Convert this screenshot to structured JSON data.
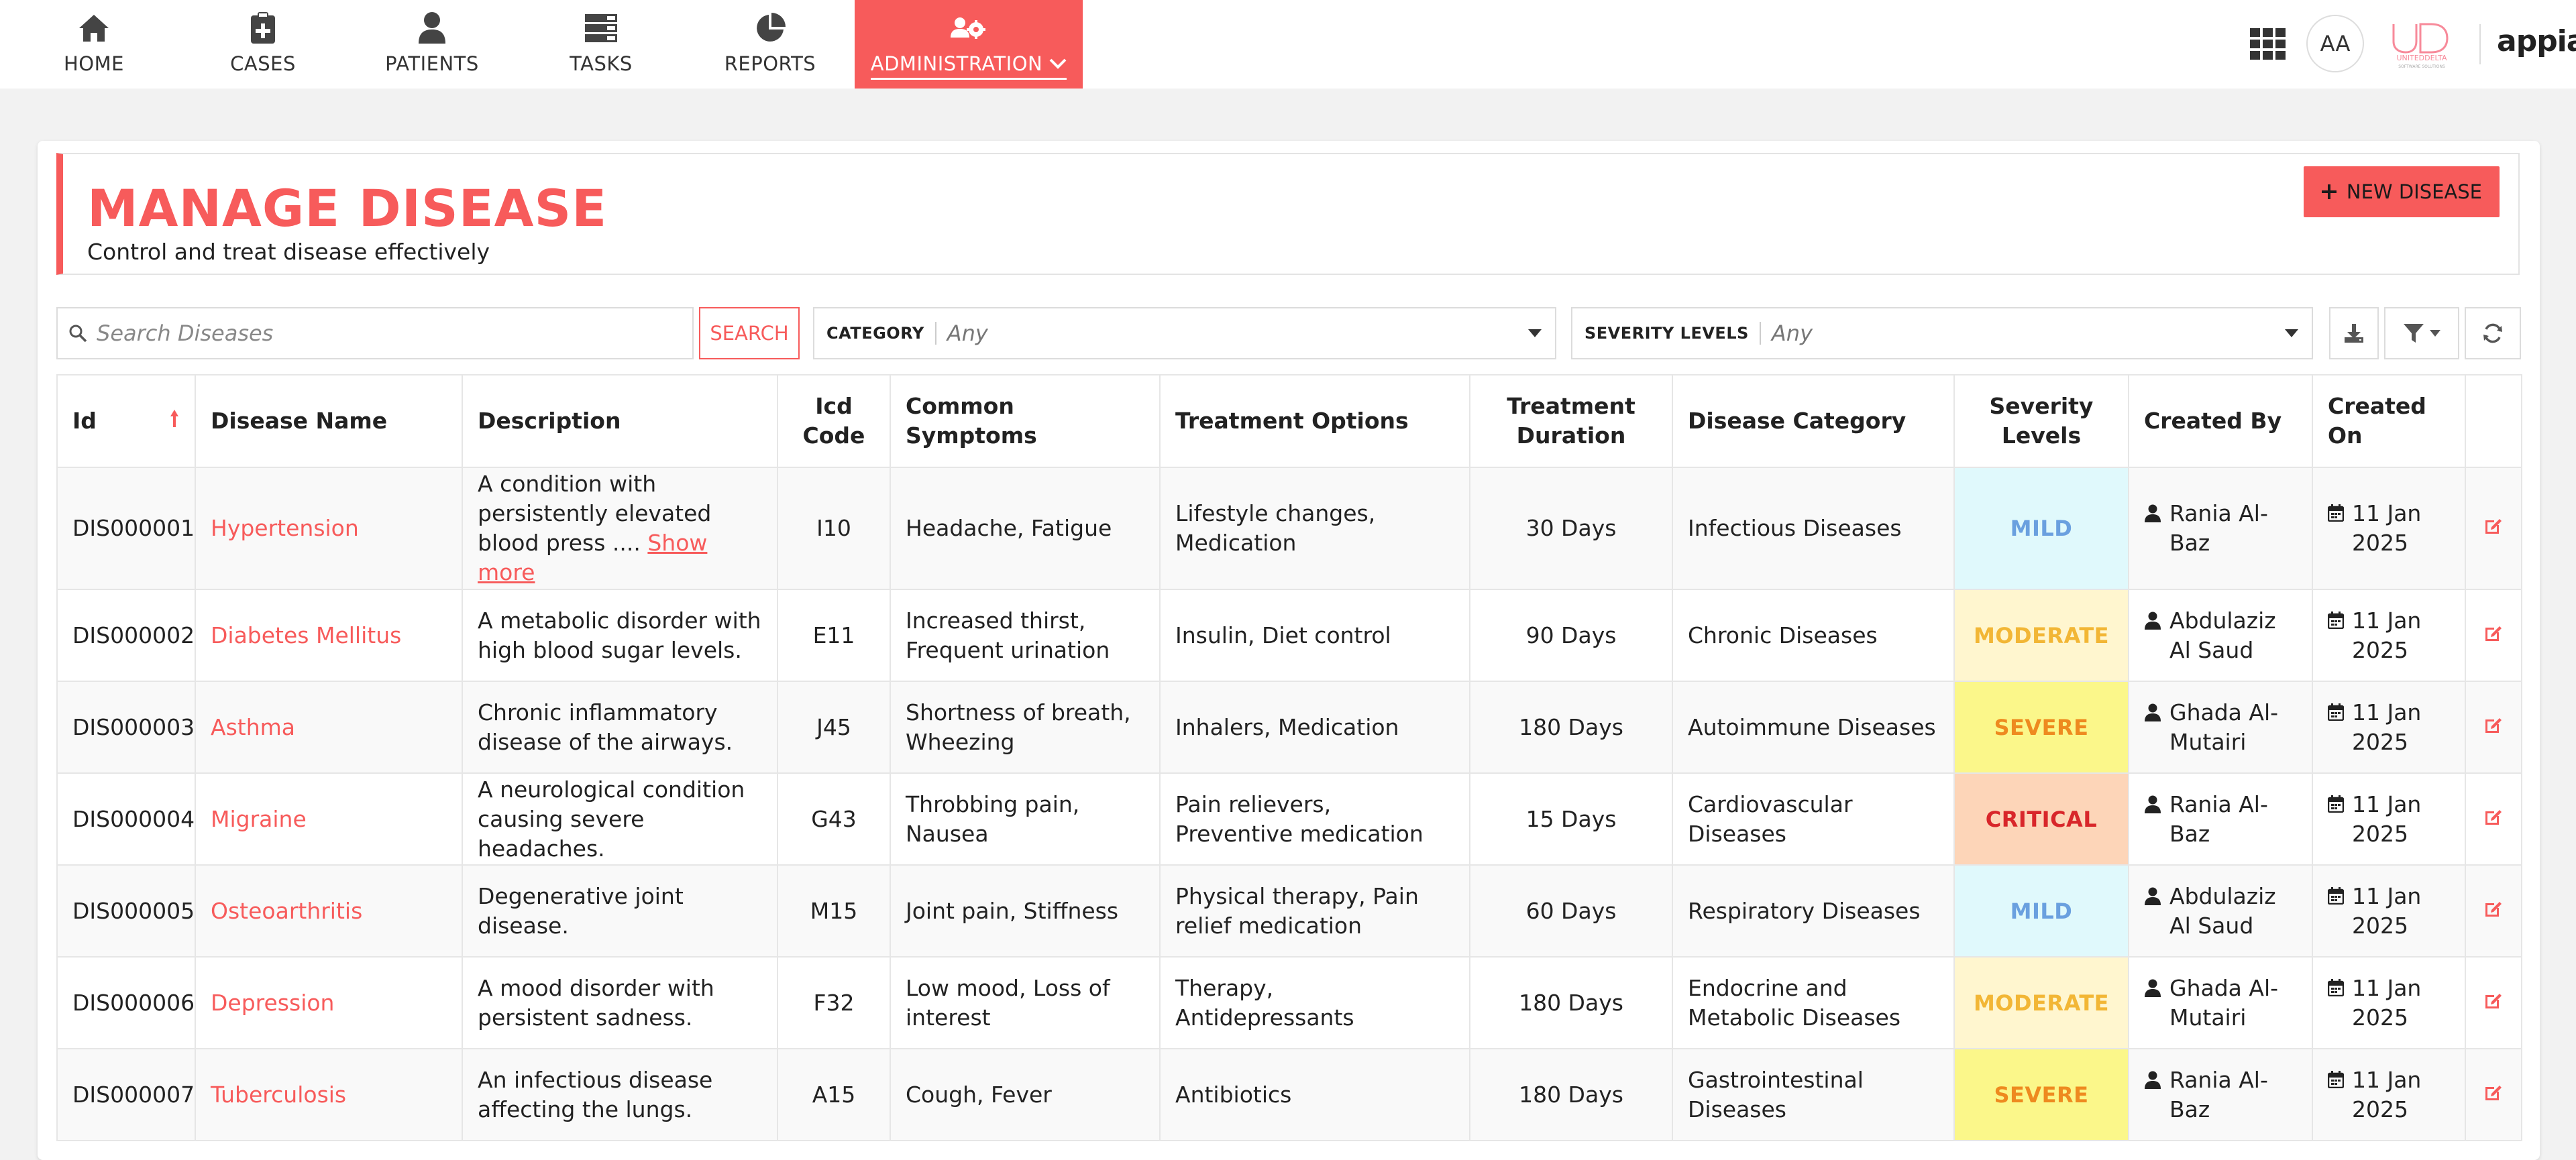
{
  "nav": {
    "items": [
      {
        "label": "HOME",
        "icon": "home-icon"
      },
      {
        "label": "CASES",
        "icon": "clipboard-plus-icon"
      },
      {
        "label": "PATIENTS",
        "icon": "user-icon"
      },
      {
        "label": "TASKS",
        "icon": "tasks-list-icon"
      },
      {
        "label": "REPORTS",
        "icon": "pie-chart-icon"
      },
      {
        "label": "ADMINISTRATION",
        "icon": "users-cog-icon",
        "active": true
      }
    ]
  },
  "user": {
    "initials": "AA"
  },
  "brand": {
    "partner_logo": "UNITEDDELTA",
    "partner_tagline": "SOFTWARE SOLUTIONS",
    "product": "appian"
  },
  "colors": {
    "accent": "#f75b5b"
  },
  "header": {
    "title": "MANAGE DISEASE",
    "subtitle": "Control and treat disease effectively",
    "new_button": "NEW DISEASE"
  },
  "filters": {
    "search_placeholder": "Search Diseases",
    "search_button": "SEARCH",
    "category_label": "CATEGORY",
    "category_value": "Any",
    "severity_label": "SEVERITY LEVELS",
    "severity_value": "Any"
  },
  "table": {
    "columns": {
      "id": "Id",
      "name": "Disease Name",
      "description": "Description",
      "icd_line1": "Icd",
      "icd_line2": "Code",
      "symptoms": "Common Symptoms",
      "treatment": "Treatment Options",
      "duration_line1": "Treatment",
      "duration_line2": "Duration",
      "category": "Disease Category",
      "severity_line1": "Severity",
      "severity_line2": "Levels",
      "created_by": "Created By",
      "created_on_line1": "Created",
      "created_on_line2": "On"
    },
    "show_more": "Show more",
    "rows": [
      {
        "id": "DIS000001",
        "name": "Hypertension",
        "description": "A condition with persistently elevated blood press ....",
        "icd": "I10",
        "symptoms": "Headache, Fatigue",
        "treatment": "Lifestyle changes, Medication",
        "duration": "30 Days",
        "category": "Infectious Diseases",
        "severity": "MILD",
        "created_by": "Rania Al-Baz",
        "created_on": "11 Jan 2025"
      },
      {
        "id": "DIS000002",
        "name": "Diabetes Mellitus",
        "description": "A metabolic disorder with high blood sugar levels.",
        "icd": "E11",
        "symptoms": "Increased thirst, Frequent urination",
        "treatment": "Insulin, Diet control",
        "duration": "90 Days",
        "category": "Chronic Diseases",
        "severity": "MODERATE",
        "created_by": "Abdulaziz Al Saud",
        "created_on": "11 Jan 2025"
      },
      {
        "id": "DIS000003",
        "name": "Asthma",
        "description": "Chronic inflammatory disease of the airways.",
        "icd": "J45",
        "symptoms": "Shortness of breath, Wheezing",
        "treatment": "Inhalers, Medication",
        "duration": "180 Days",
        "category": "Autoimmune Diseases",
        "severity": "SEVERE",
        "created_by": "Ghada Al-Mutairi",
        "created_on": "11 Jan 2025"
      },
      {
        "id": "DIS000004",
        "name": "Migraine",
        "description": "A neurological condition causing severe headaches.",
        "icd": "G43",
        "symptoms": "Throbbing pain, Nausea",
        "treatment": "Pain relievers, Preventive medication",
        "duration": "15 Days",
        "category": "Cardiovascular Diseases",
        "severity": "CRITICAL",
        "created_by": "Rania Al-Baz",
        "created_on": "11 Jan 2025"
      },
      {
        "id": "DIS000005",
        "name": "Osteoarthritis",
        "description": "Degenerative joint disease.",
        "icd": "M15",
        "symptoms": "Joint pain, Stiffness",
        "treatment": "Physical therapy, Pain relief medication",
        "duration": "60 Days",
        "category": "Respiratory Diseases",
        "severity": "MILD",
        "created_by": "Abdulaziz Al Saud",
        "created_on": "11 Jan 2025"
      },
      {
        "id": "DIS000006",
        "name": "Depression",
        "description": "A mood disorder with persistent sadness.",
        "icd": "F32",
        "symptoms": "Low mood, Loss of interest",
        "treatment": "Therapy, Antidepressants",
        "duration": "180 Days",
        "category": "Endocrine and Metabolic Diseases",
        "severity": "MODERATE",
        "created_by": "Ghada Al-Mutairi",
        "created_on": "11 Jan 2025"
      },
      {
        "id": "DIS000007",
        "name": "Tuberculosis",
        "description": "An infectious disease affecting the lungs.",
        "icd": "A15",
        "symptoms": "Cough, Fever",
        "treatment": "Antibiotics",
        "duration": "180 Days",
        "category": "Gastrointestinal Diseases",
        "severity": "SEVERE",
        "created_by": "Rania Al-Baz",
        "created_on": "11 Jan 2025"
      }
    ]
  },
  "severity_styles": {
    "MILD": {
      "bg": "#e0f9fc",
      "fg": "#6aa0df"
    },
    "MODERATE": {
      "bg": "#fff6cf",
      "fg": "#f2b635"
    },
    "SEVERE": {
      "bg": "#fbf78a",
      "fg": "#ee8a1f"
    },
    "CRITICAL": {
      "bg": "#fdd5b8",
      "fg": "#d8262a"
    }
  }
}
